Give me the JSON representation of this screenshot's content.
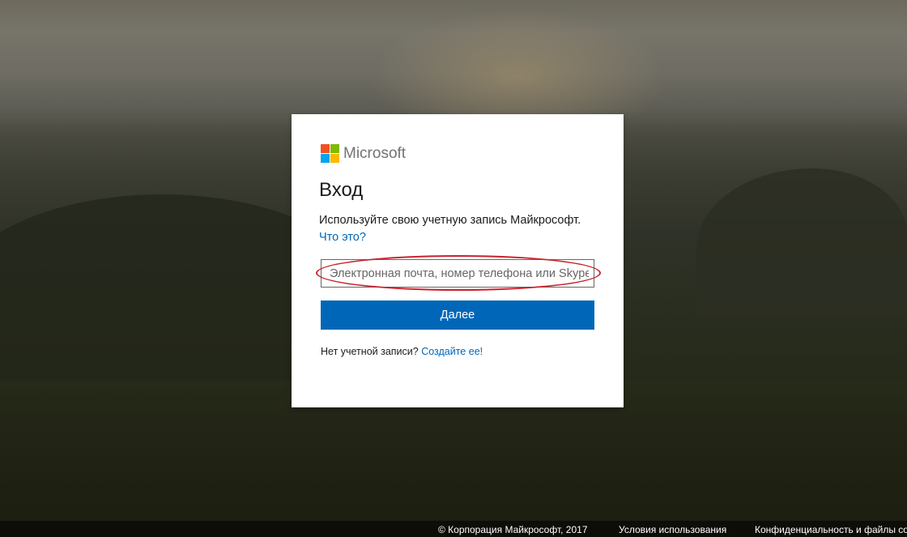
{
  "brand": {
    "name": "Microsoft",
    "colors": [
      "#f25022",
      "#7fba00",
      "#00a4ef",
      "#ffb900"
    ]
  },
  "signin": {
    "title": "Вход",
    "subtitle": "Используйте свою учетную запись Майкрософт.",
    "help_link": "Что это?",
    "email_placeholder": "Электронная почта, номер телефона или Skype",
    "email_value": "",
    "next_label": "Далее",
    "no_account_text": "Нет учетной записи?",
    "create_link": "Создайте ее!"
  },
  "footer": {
    "copyright": "© Корпорация Майкрософт, 2017",
    "terms": "Условия использования",
    "privacy": "Конфиденциальность и файлы cookie"
  },
  "annotation": {
    "highlight_color": "#c8222c"
  }
}
